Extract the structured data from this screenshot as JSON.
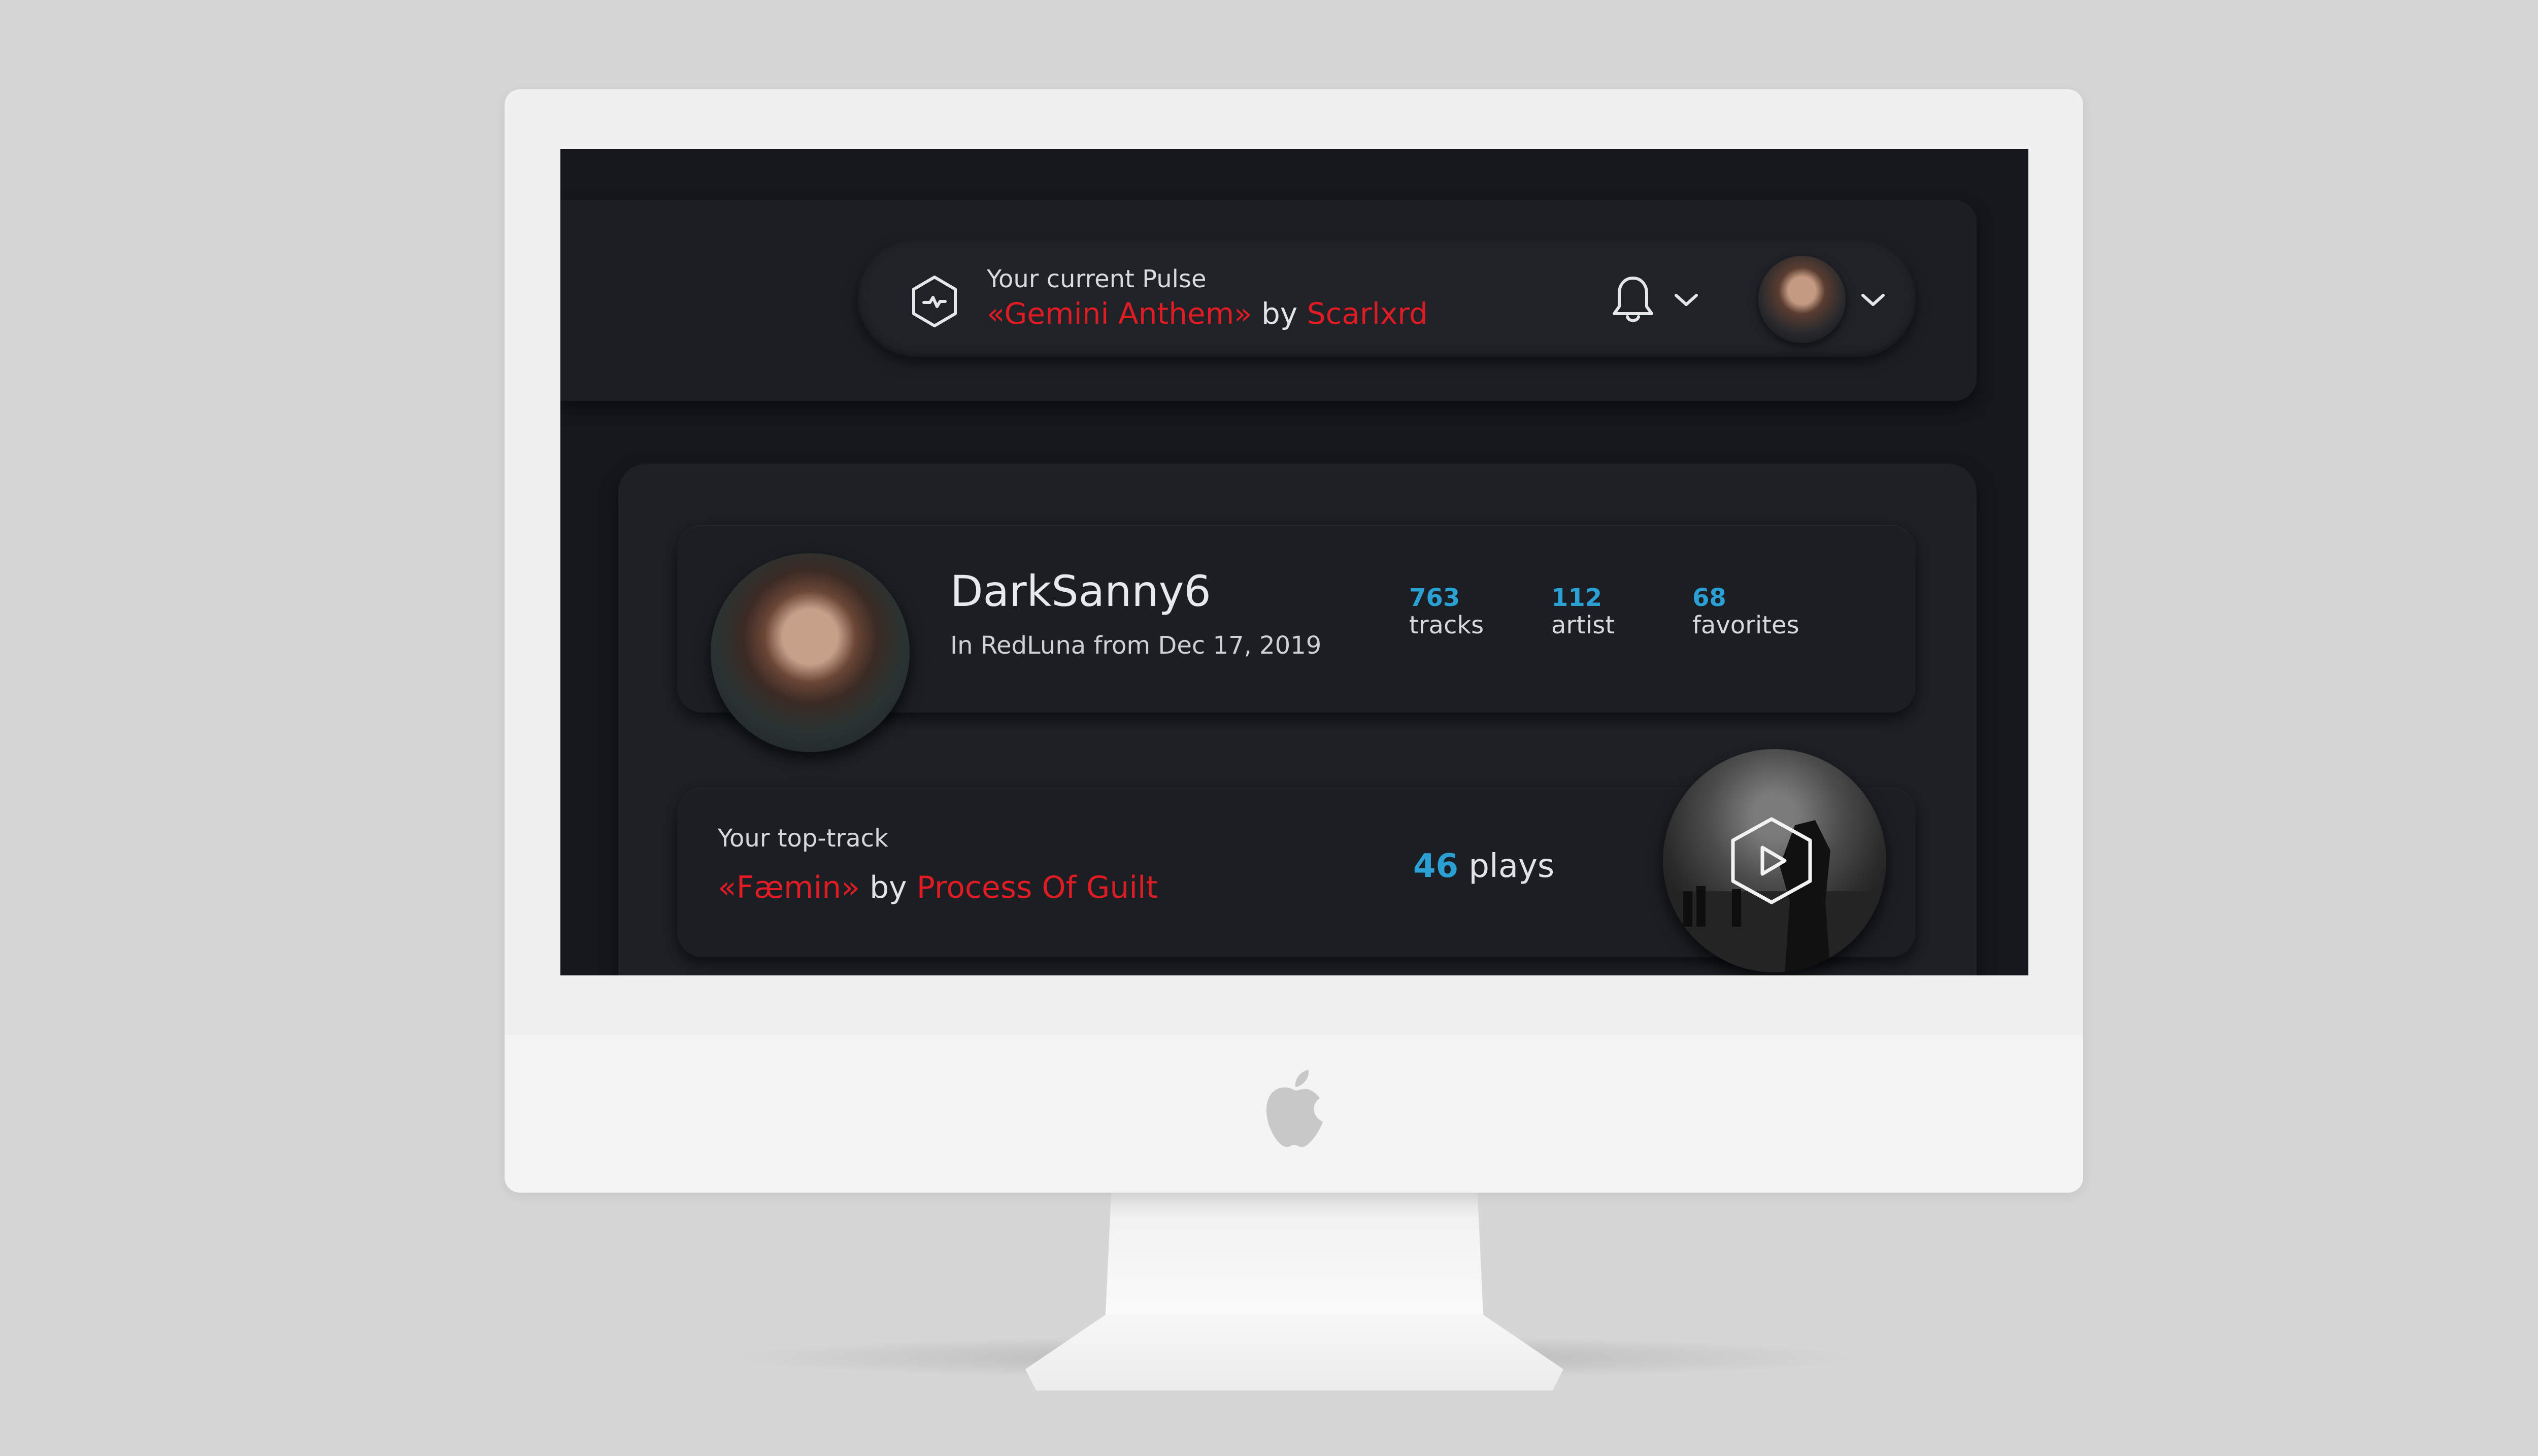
{
  "colors": {
    "accent_red": "#e01b24",
    "accent_blue": "#2aa0d4",
    "screen_bg": "#14171c",
    "panel_bg": "#1d2025"
  },
  "header": {
    "pulse_icon": "pulse-hexagon-icon",
    "pulse_label": "Your current Pulse",
    "current_track": {
      "title": "«Gemini Anthem»",
      "by": " by ",
      "artist": "Scarlxrd"
    },
    "notification_icon": "bell-icon",
    "dropdown_icon": "chevron-down-icon"
  },
  "profile": {
    "username": "DarkSanny6",
    "member_since": "In RedLuna from Dec 17, 2019",
    "stats": [
      {
        "value": "763",
        "label": "tracks"
      },
      {
        "value": "112",
        "label": "artist"
      },
      {
        "value": "68",
        "label": "favorites"
      }
    ]
  },
  "top_track": {
    "label": "Your top-track",
    "title": "«Fæmin»",
    "by": " by ",
    "artist": "Process Of Guilt",
    "plays_value": "46",
    "plays_label": " plays",
    "play_icon": "play-hexagon-icon"
  }
}
